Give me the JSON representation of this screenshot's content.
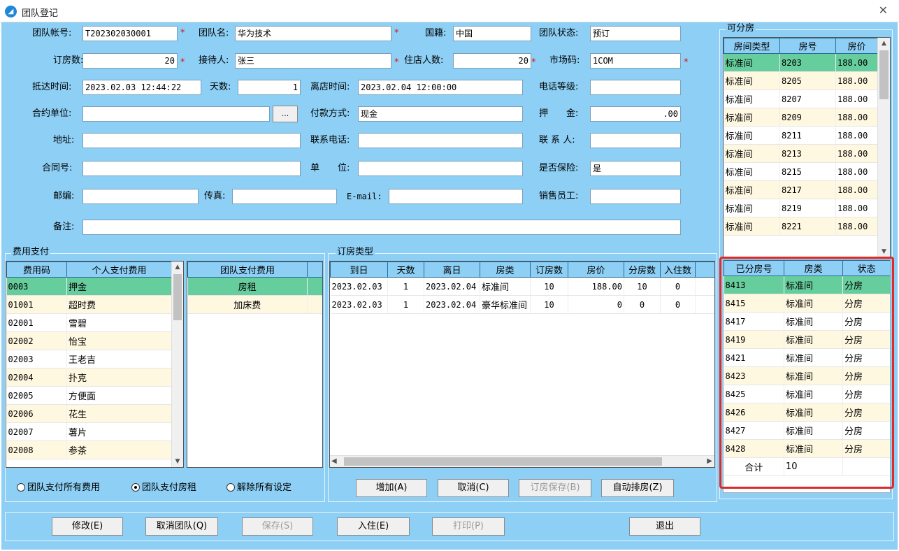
{
  "window": {
    "title": "团队登记"
  },
  "form": {
    "team_account": {
      "label": "团队帐号:",
      "value": "T202302030001"
    },
    "team_name": {
      "label": "团队名:",
      "value": "华为技术"
    },
    "nationality": {
      "label": "国籍:",
      "value": "中国"
    },
    "team_status": {
      "label": "团队状态:",
      "value": "预订"
    },
    "room_count": {
      "label": "订房数:",
      "value": "20"
    },
    "receiver": {
      "label": "接待人:",
      "value": "张三"
    },
    "guest_count": {
      "label": "住店人数:",
      "value": "20"
    },
    "market_code": {
      "label": "市场码:",
      "value": "1COM"
    },
    "arrival_time": {
      "label": "抵达时间:",
      "value": "2023.02.03 12:44:22"
    },
    "days": {
      "label": "天数:",
      "value": "1"
    },
    "departure_time": {
      "label": "离店时间:",
      "value": "2023.02.04 12:00:00"
    },
    "phone_level": {
      "label": "电话等级:",
      "value": ""
    },
    "contract_unit": {
      "label": "合约单位:",
      "value": ""
    },
    "ellipsis_label": "...",
    "payment_method": {
      "label": "付款方式:",
      "value": "现金"
    },
    "deposit": {
      "label": "押　　金:",
      "value": ".00"
    },
    "address": {
      "label": "地址:",
      "value": ""
    },
    "contact_phone": {
      "label": "联系电话:",
      "value": ""
    },
    "contact_person": {
      "label": "联 系 人:",
      "value": ""
    },
    "contract_no": {
      "label": "合同号:",
      "value": ""
    },
    "unit": {
      "label": "单　　位:",
      "value": ""
    },
    "insured": {
      "label": "是否保险:",
      "value": "是"
    },
    "postcode": {
      "label": "邮编:",
      "value": ""
    },
    "fax": {
      "label": "传真:",
      "value": ""
    },
    "email": {
      "label": "E-mail:",
      "value": ""
    },
    "sales_staff": {
      "label": "销售员工:",
      "value": ""
    },
    "remarks": {
      "label": "备注:",
      "value": ""
    },
    "required_mark": "*"
  },
  "fees": {
    "title": "费用支付",
    "personal": {
      "headers": [
        "费用码",
        "个人支付费用"
      ],
      "rows": [
        [
          "0003",
          "押金"
        ],
        [
          "01001",
          "超时费"
        ],
        [
          "02001",
          "雪碧"
        ],
        [
          "02002",
          "怡宝"
        ],
        [
          "02003",
          "王老吉"
        ],
        [
          "02004",
          "扑克"
        ],
        [
          "02005",
          "方便面"
        ],
        [
          "02006",
          "花生"
        ],
        [
          "02007",
          "薯片"
        ],
        [
          "02008",
          "参茶"
        ]
      ]
    },
    "team": {
      "headers": [
        "团队支付费用"
      ],
      "rows": [
        [
          "房租"
        ],
        [
          "加床费"
        ]
      ]
    },
    "radios": [
      {
        "label": "团队支付所有费用",
        "checked": false
      },
      {
        "label": "团队支付房租",
        "checked": true
      },
      {
        "label": "解除所有设定",
        "checked": false
      }
    ]
  },
  "booking": {
    "title": "订房类型",
    "headers": [
      "到日",
      "天数",
      "离日",
      "房类",
      "订房数",
      "房价",
      "分房数",
      "入住数"
    ],
    "rows": [
      [
        "2023.02.03",
        "1",
        "2023.02.04",
        "标准间",
        "10",
        "188.00",
        "10",
        "0"
      ],
      [
        "2023.02.03",
        "1",
        "2023.02.04",
        "豪华标准间",
        "10",
        "0",
        "0",
        "0"
      ]
    ],
    "buttons": {
      "add": "增加(A)",
      "cancel": "取消(C)",
      "save": "订房保存(B)",
      "auto": "自动排房(Z)"
    }
  },
  "available": {
    "title": "可分房",
    "headers": [
      "房间类型",
      "房号",
      "房价"
    ],
    "rows": [
      [
        "标准间",
        "8203",
        "188.00"
      ],
      [
        "标准间",
        "8205",
        "188.00"
      ],
      [
        "标准间",
        "8207",
        "188.00"
      ],
      [
        "标准间",
        "8209",
        "188.00"
      ],
      [
        "标准间",
        "8211",
        "188.00"
      ],
      [
        "标准间",
        "8213",
        "188.00"
      ],
      [
        "标准间",
        "8215",
        "188.00"
      ],
      [
        "标准间",
        "8217",
        "188.00"
      ],
      [
        "标准间",
        "8219",
        "188.00"
      ],
      [
        "标准间",
        "8221",
        "188.00"
      ]
    ]
  },
  "assigned": {
    "headers": [
      "已分房号",
      "房类",
      "状态"
    ],
    "rows": [
      [
        "8413",
        "标准间",
        "分房"
      ],
      [
        "8415",
        "标准间",
        "分房"
      ],
      [
        "8417",
        "标准间",
        "分房"
      ],
      [
        "8419",
        "标准间",
        "分房"
      ],
      [
        "8421",
        "标准间",
        "分房"
      ],
      [
        "8423",
        "标准间",
        "分房"
      ],
      [
        "8425",
        "标准间",
        "分房"
      ],
      [
        "8426",
        "标准间",
        "分房"
      ],
      [
        "8427",
        "标准间",
        "分房"
      ],
      [
        "8428",
        "标准间",
        "分房"
      ]
    ],
    "total_label": "合计",
    "total_value": "10"
  },
  "actions": {
    "modify": "修改(E)",
    "cancel_team": "取消团队(Q)",
    "save": "保存(S)",
    "checkin": "入住(E)",
    "print": "打印(P)",
    "exit": "退出"
  },
  "colors": {
    "background": "#8dcff5",
    "selected_row": "#66cd9d",
    "alt_row": "#fff8e1",
    "highlight": "#e02a2a",
    "required": "#e01010"
  }
}
